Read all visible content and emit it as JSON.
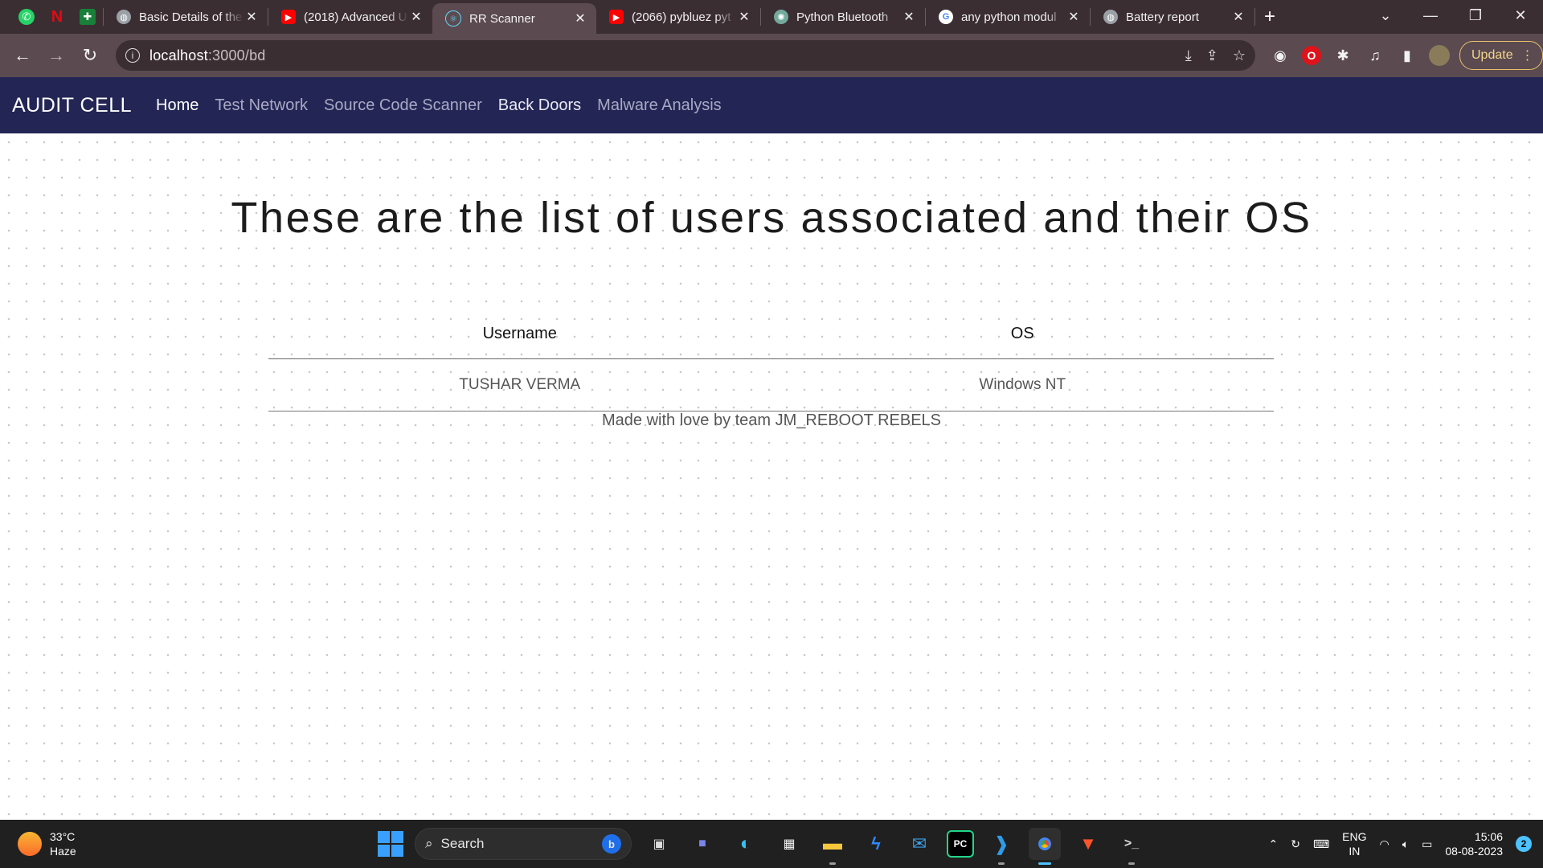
{
  "browser": {
    "pinned_tabs": [
      {
        "icon": "whatsapp-icon",
        "glyph": "✆",
        "color": "#25d366"
      },
      {
        "icon": "netflix-icon",
        "glyph": "N",
        "color": "#e50914"
      },
      {
        "icon": "google-sheets-icon",
        "glyph": "✚",
        "color": "#188038"
      }
    ],
    "tabs": [
      {
        "title": "Basic Details of the",
        "icon": "globe-icon",
        "active": false
      },
      {
        "title": "(2018) Advanced U",
        "icon": "youtube-icon",
        "active": false
      },
      {
        "title": "RR Scanner",
        "icon": "react-icon",
        "active": true
      },
      {
        "title": "(2066) pybluez pyt",
        "icon": "youtube-icon",
        "active": false
      },
      {
        "title": "Python Bluetooth",
        "icon": "chatgpt-icon",
        "active": false
      },
      {
        "title": "any python modul",
        "icon": "google-icon",
        "active": false
      },
      {
        "title": "Battery report",
        "icon": "globe-icon",
        "active": false
      }
    ],
    "address": {
      "host": "localhost",
      "path": ":3000/bd"
    },
    "update_label": "Update"
  },
  "app": {
    "brand": "AUDIT CELL",
    "nav": [
      "Home",
      "Test Network",
      "Source Code Scanner",
      "Back Doors",
      "Malware Analysis"
    ],
    "heading": "These are the list of users associated and their OS",
    "table": {
      "headers": [
        "Username",
        "OS"
      ],
      "rows": [
        [
          "TUSHAR VERMA",
          "Windows NT"
        ]
      ]
    },
    "footer": "Made with love by team JM_REBOOT REBELS",
    "colors": {
      "navbar": "#232555",
      "accent_text": "#ffffff"
    }
  },
  "taskbar": {
    "weather": {
      "temp": "33°C",
      "condition": "Haze"
    },
    "search_label": "Search",
    "lang": {
      "line1": "ENG",
      "line2": "IN"
    },
    "clock": {
      "time": "15:06",
      "date": "08-08-2023"
    },
    "notifications": "2"
  }
}
